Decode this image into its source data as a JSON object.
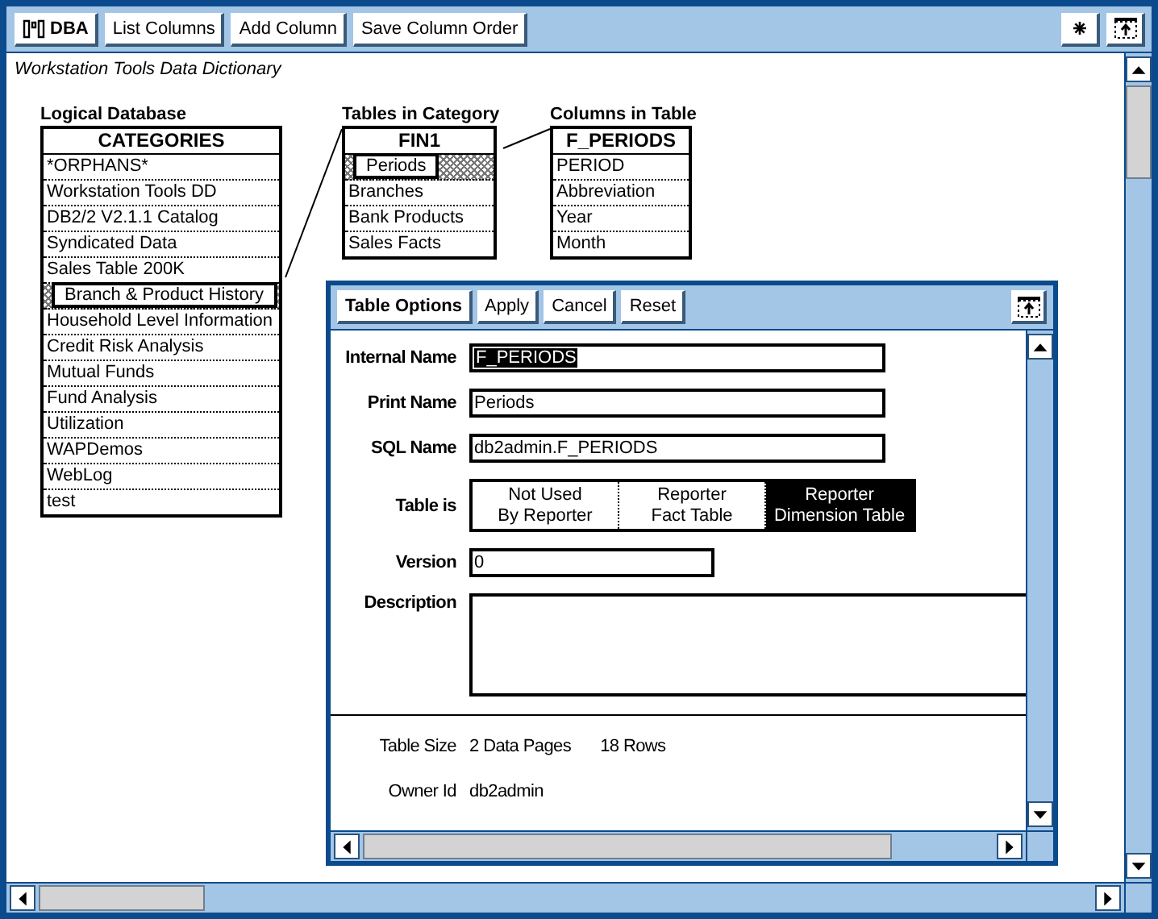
{
  "toolbar": {
    "buttons": [
      {
        "label": "DBA",
        "kind": "menu"
      },
      {
        "label": "List Columns",
        "kind": "action"
      },
      {
        "label": "Add Column",
        "kind": "action"
      },
      {
        "label": "Save Column Order",
        "kind": "action"
      }
    ]
  },
  "title": "Workstation Tools Data Dictionary",
  "panels": [
    {
      "heading": "Logical Database",
      "list_title": "CATEGORIES",
      "items": [
        {
          "label": "*ORPHANS*",
          "selected": false
        },
        {
          "label": "Workstation Tools DD",
          "selected": false
        },
        {
          "label": "DB2/2 V2.1.1 Catalog",
          "selected": false
        },
        {
          "label": "Syndicated Data",
          "selected": false
        },
        {
          "label": "Sales Table 200K",
          "selected": false
        },
        {
          "label": "Branch & Product History",
          "selected": true
        },
        {
          "label": "Household Level Information",
          "selected": false
        },
        {
          "label": "Credit Risk Analysis",
          "selected": false
        },
        {
          "label": "Mutual Funds",
          "selected": false
        },
        {
          "label": "Fund Analysis",
          "selected": false
        },
        {
          "label": "Utilization",
          "selected": false
        },
        {
          "label": "WAPDemos",
          "selected": false
        },
        {
          "label": "WebLog",
          "selected": false
        },
        {
          "label": "test",
          "selected": false
        }
      ]
    },
    {
      "heading": "Tables in Category",
      "list_title": "FIN1",
      "items": [
        {
          "label": "Periods",
          "selected": true
        },
        {
          "label": "Branches",
          "selected": false
        },
        {
          "label": "Bank Products",
          "selected": false
        },
        {
          "label": "Sales Facts",
          "selected": false
        }
      ]
    },
    {
      "heading": "Columns in Table",
      "list_title": "F_PERIODS",
      "items": [
        {
          "label": "PERIOD",
          "selected": false
        },
        {
          "label": "Abbreviation",
          "selected": false
        },
        {
          "label": "Year",
          "selected": false
        },
        {
          "label": "Month",
          "selected": false
        }
      ]
    }
  ],
  "dialog": {
    "buttons": [
      {
        "label": "Table Options",
        "kind": "menu"
      },
      {
        "label": "Apply",
        "kind": "action"
      },
      {
        "label": "Cancel",
        "kind": "action"
      },
      {
        "label": "Reset",
        "kind": "action"
      }
    ],
    "fields": [
      {
        "kind": "text",
        "label": "Internal Name",
        "value": "F_PERIODS",
        "text_selected": true
      },
      {
        "kind": "text",
        "label": "Print Name",
        "value": "Periods",
        "text_selected": false
      },
      {
        "kind": "text",
        "label": "SQL Name",
        "value": "db2admin.F_PERIODS",
        "text_selected": false
      },
      {
        "kind": "choice",
        "label": "Table is",
        "options": [
          {
            "label": "Not Used By Reporter",
            "selected": false
          },
          {
            "label": "Reporter Fact Table",
            "selected": false
          },
          {
            "label": "Reporter Dimension Table",
            "selected": true
          }
        ]
      },
      {
        "kind": "short",
        "label": "Version",
        "value": "0",
        "text_selected": false
      },
      {
        "kind": "area",
        "label": "Description"
      }
    ],
    "info": [
      {
        "label": "Table Size",
        "values": [
          "2 Data Pages",
          "18 Rows"
        ]
      },
      {
        "label": "Owner Id",
        "values": [
          "db2admin"
        ]
      }
    ]
  }
}
